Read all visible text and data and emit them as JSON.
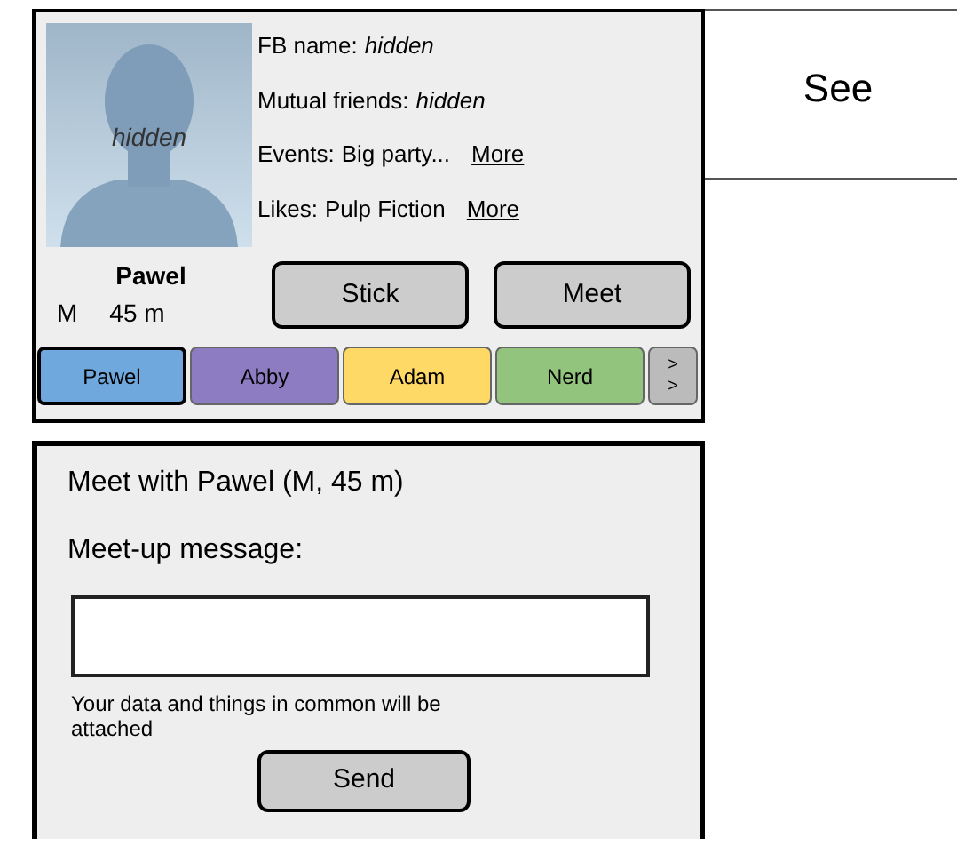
{
  "profile": {
    "photo_label": "hidden",
    "name": "Pawel",
    "gender": "M",
    "distance": "45 m",
    "details": [
      {
        "label": "FB name:",
        "value": "hidden",
        "hidden": true
      },
      {
        "label": "Mutual friends:",
        "value": "hidden",
        "hidden": true
      },
      {
        "label": "Events:",
        "value": "Big party...",
        "hidden": false,
        "link": "More"
      },
      {
        "label": "Likes:",
        "value": "Pulp Fiction",
        "hidden": false,
        "link": "More"
      }
    ],
    "buttons": [
      "Stick",
      "Meet"
    ]
  },
  "tabs": [
    {
      "label": "Pawel",
      "selected": true,
      "color": "#6fa8dc"
    },
    {
      "label": "Abby",
      "selected": false,
      "color": "#8e7cc3"
    },
    {
      "label": "Adam",
      "selected": false,
      "color": "#ffd966"
    },
    {
      "label": "Nerd",
      "selected": false,
      "color": "#93c47d"
    }
  ],
  "more_tabs": [
    ">",
    ">"
  ],
  "side_panel": {
    "title": "See"
  },
  "meet_dialog": {
    "title": "Meet with Pawel (M, 45 m)",
    "message_label": "Meet-up message:",
    "note": "Your data and things in common will be attached",
    "send_button": "Send"
  }
}
